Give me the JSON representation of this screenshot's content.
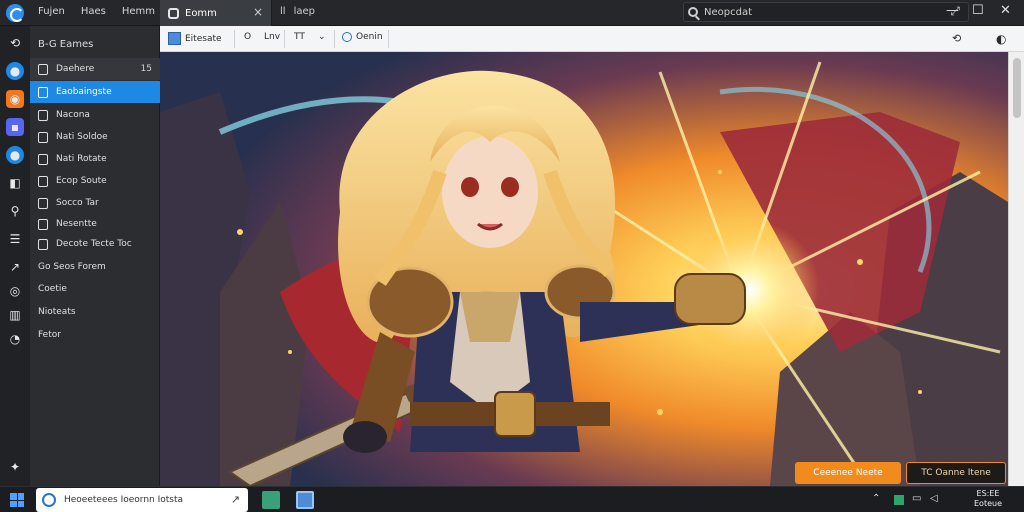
{
  "titlebar": {
    "menu": [
      "Fujen",
      "Haes",
      "Hemm"
    ],
    "tab_label": "Eomm",
    "tab_close": "×",
    "tab2": [
      "ll",
      "laep"
    ],
    "search_value": "Neopcdat",
    "search_pin": "⤢",
    "win_min": "—",
    "win_max": "☐",
    "win_close": "✕"
  },
  "sidebar": {
    "header": "B-G Eames",
    "items": [
      {
        "label": "Daehere",
        "count": "15"
      },
      {
        "label": "Eaobaingste"
      },
      {
        "label": "Nacona"
      },
      {
        "label": "Nati Soldoe"
      },
      {
        "label": "Nati Rotate"
      },
      {
        "label": "Ecop Soute"
      },
      {
        "label": "Socco Tar"
      },
      {
        "label": "Nesentte"
      },
      {
        "label": "Decote Tecte Toc"
      }
    ],
    "plain": [
      "Go Seos Forem",
      "Coetie",
      "Nioteats",
      "Fetor"
    ]
  },
  "toolbar": {
    "item1": "Eitesate",
    "item2": "O",
    "item3": "Lnv",
    "item4": "TT",
    "item5": "⌄",
    "item6": "Oenin",
    "right1": "⟲",
    "right2": "◐"
  },
  "actions": {
    "primary": "Ceeenee Neete",
    "secondary": "TC Oanne Itene"
  },
  "taskbar": {
    "search_value": "Heoeeteees Ioeornn Iotsta",
    "clock_line1": "ES:EE",
    "clock_line2": "Eoteue"
  },
  "colors": {
    "accent": "#1e88e5",
    "action_orange": "#f28b1d"
  }
}
